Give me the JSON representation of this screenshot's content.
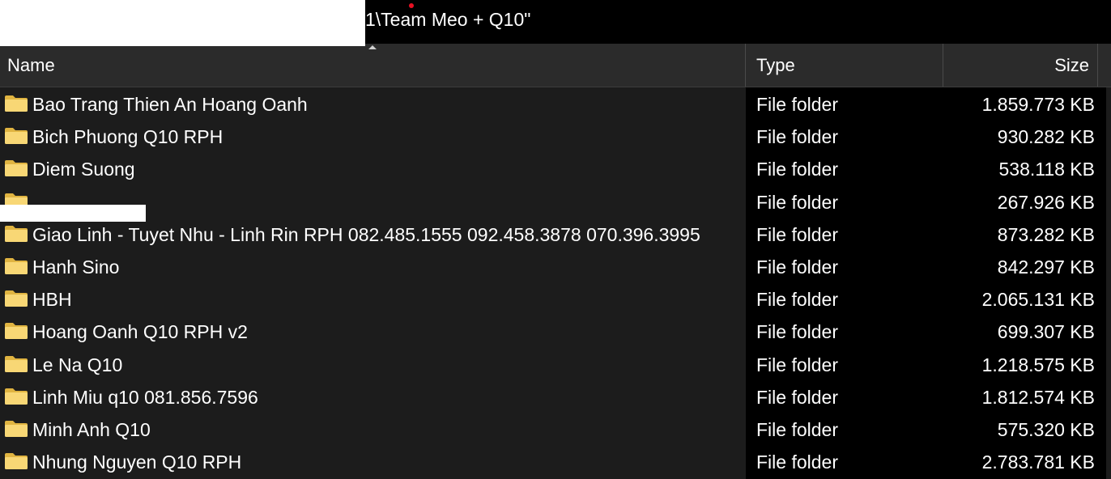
{
  "window": {
    "path_fragment": "1\\Team Meo + Q10\""
  },
  "columns": {
    "name": "Name",
    "type": "Type",
    "size": "Size"
  },
  "files": [
    {
      "name": "Bao Trang Thien An Hoang Oanh",
      "type": "File folder",
      "size": "1.859.773 KB",
      "icon": "folder-icon"
    },
    {
      "name": "Bich Phuong Q10 RPH",
      "type": "File folder",
      "size": "930.282 KB",
      "icon": "folder-icon"
    },
    {
      "name": "Diem Suong",
      "type": "File folder",
      "size": "538.118 KB",
      "icon": "folder-icon"
    },
    {
      "name": "",
      "type": "File folder",
      "size": "267.926 KB",
      "icon": "folder-icon"
    },
    {
      "name": "Giao Linh - Tuyet Nhu - Linh Rin RPH 082.485.1555 092.458.3878 070.396.3995",
      "type": "File folder",
      "size": "873.282 KB",
      "icon": "folder-icon"
    },
    {
      "name": "Hanh Sino",
      "type": "File folder",
      "size": "842.297 KB",
      "icon": "folder-icon"
    },
    {
      "name": "HBH",
      "type": "File folder",
      "size": "2.065.131 KB",
      "icon": "folder-icon"
    },
    {
      "name": "Hoang Oanh Q10 RPH v2",
      "type": "File folder",
      "size": "699.307 KB",
      "icon": "folder-icon"
    },
    {
      "name": "Le Na Q10",
      "type": "File folder",
      "size": "1.218.575 KB",
      "icon": "folder-icon"
    },
    {
      "name": "Linh Miu q10 081.856.7596",
      "type": "File folder",
      "size": "1.812.574 KB",
      "icon": "folder-icon"
    },
    {
      "name": "Minh Anh Q10",
      "type": "File folder",
      "size": "575.320 KB",
      "icon": "folder-icon"
    },
    {
      "name": "Nhung Nguyen Q10 RPH",
      "type": "File folder",
      "size": "2.783.781 KB",
      "icon": "folder-icon"
    }
  ],
  "colors": {
    "background": "#000000",
    "name_column_bg": "#1c1c1c",
    "header_bg": "#2b2b2b",
    "text": "#ffffff",
    "folder_yellow": "#f8d775",
    "folder_dark": "#e0b441",
    "accent_red": "#e81123"
  }
}
